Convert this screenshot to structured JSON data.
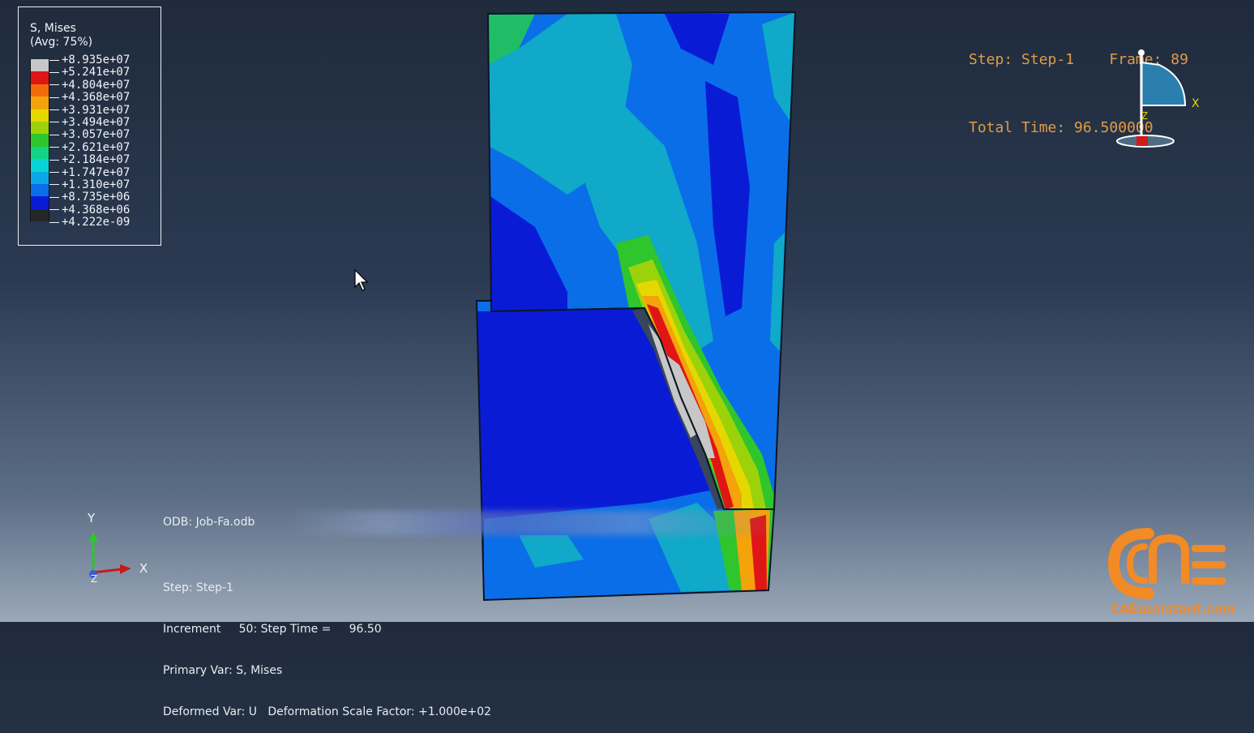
{
  "legend": {
    "title_line1": "S, Mises",
    "title_line2": "(Avg: 75%)",
    "colors": [
      "#c7c7c7",
      "#e01515",
      "#f26b0b",
      "#f4a30a",
      "#e5d800",
      "#9cd20a",
      "#2fc52c",
      "#13d386",
      "#08d4d6",
      "#0aa8e6",
      "#0a6ee8",
      "#0a1bd6",
      "#262626"
    ],
    "values": [
      "+8.935e+07",
      "+5.241e+07",
      "+4.804e+07",
      "+4.368e+07",
      "+3.931e+07",
      "+3.494e+07",
      "+3.057e+07",
      "+2.621e+07",
      "+2.184e+07",
      "+1.747e+07",
      "+1.310e+07",
      "+8.735e+06",
      "+4.368e+06",
      "+4.222e-09"
    ]
  },
  "status": {
    "line1": "Step: Step-1    Frame: 89",
    "line2": "Total Time: 96.500000"
  },
  "triad3d": {
    "x_label": "X",
    "z_label": "Z"
  },
  "triad2d": {
    "x_label": "X",
    "y_label": "Y",
    "z_label": "Z"
  },
  "info": {
    "odb": "ODB: Job-Fa.odb",
    "step": "Step: Step-1",
    "increment": "Increment     50: Step Time =     96.50",
    "primary": "Primary Var: S, Mises",
    "deformed": "Deformed Var: U   Deformation Scale Factor: +1.000e+02"
  },
  "logo": {
    "text": "CAEassistant.com",
    "color": "#f28a26"
  }
}
